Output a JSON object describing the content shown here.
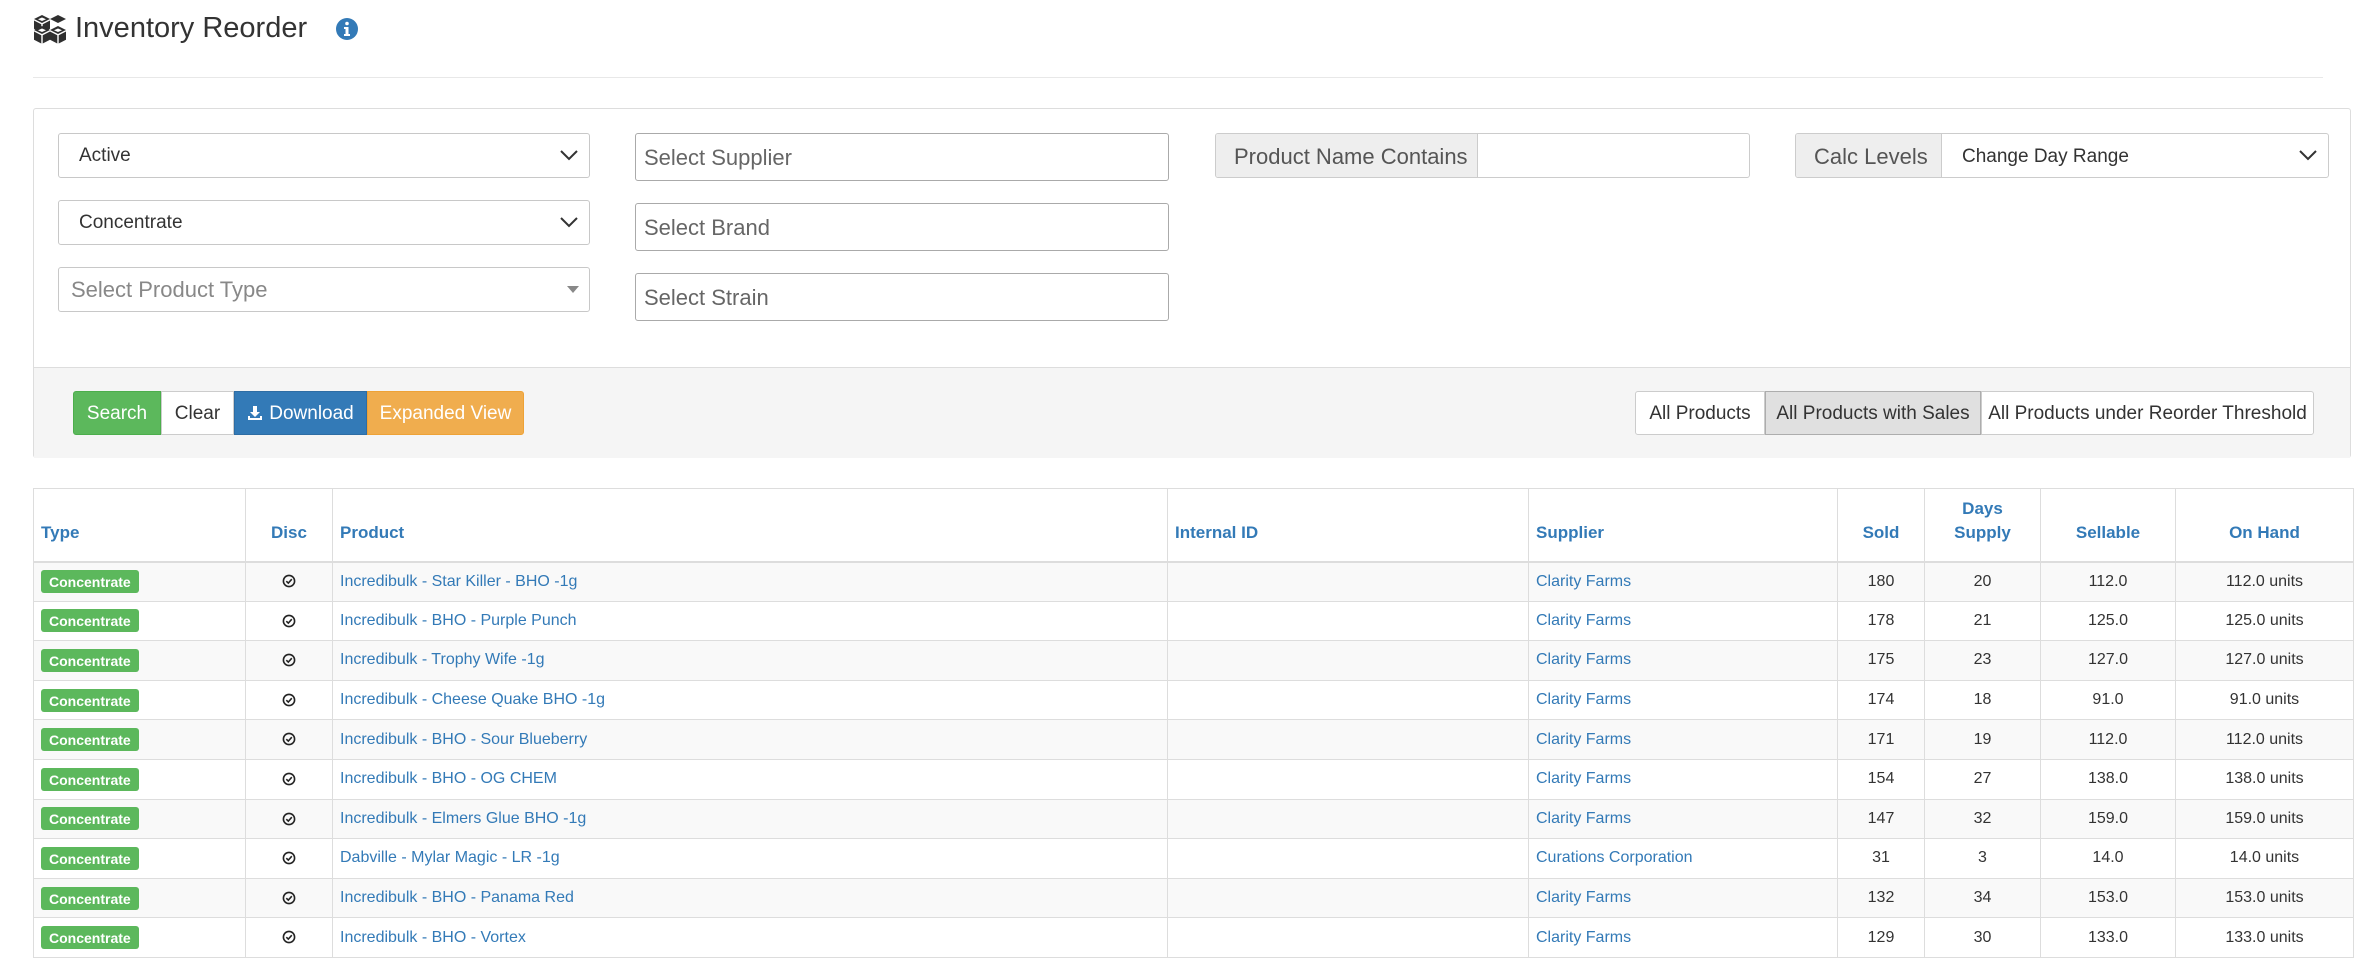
{
  "header": {
    "title": "Inventory Reorder"
  },
  "filters": {
    "status_select": "Active",
    "category_select": "Concentrate",
    "product_type_placeholder": "Select Product Type",
    "supplier_placeholder": "Select Supplier",
    "brand_placeholder": "Select Brand",
    "strain_placeholder": "Select Strain",
    "product_name_label": "Product Name Contains",
    "product_name_value": "",
    "calc_levels_label": "Calc Levels",
    "day_range_select": "Change Day Range"
  },
  "actions": {
    "search": "Search",
    "clear": "Clear",
    "download": "Download",
    "expanded": "Expanded View"
  },
  "views": {
    "all_products": "All Products",
    "all_with_sales": "All Products with Sales",
    "under_threshold": "All Products under Reorder Threshold",
    "active_view": "All Products with Sales"
  },
  "table": {
    "columns": {
      "type": "Type",
      "disc": "Disc",
      "product": "Product",
      "internal_id": "Internal ID",
      "supplier": "Supplier",
      "sold": "Sold",
      "days_supply_1": "Days",
      "days_supply_2": "Supply",
      "sellable": "Sellable",
      "on_hand": "On Hand"
    },
    "rows": [
      {
        "type": "Concentrate",
        "product": "Incredibulk - Star Killer - BHO -1g",
        "internal_id": "",
        "supplier": "Clarity Farms",
        "sold": "180",
        "days_supply": "20",
        "sellable": "112.0",
        "on_hand": "112.0 units"
      },
      {
        "type": "Concentrate",
        "product": "Incredibulk - BHO - Purple Punch",
        "internal_id": "",
        "supplier": "Clarity Farms",
        "sold": "178",
        "days_supply": "21",
        "sellable": "125.0",
        "on_hand": "125.0 units"
      },
      {
        "type": "Concentrate",
        "product": "Incredibulk - Trophy Wife -1g",
        "internal_id": "",
        "supplier": "Clarity Farms",
        "sold": "175",
        "days_supply": "23",
        "sellable": "127.0",
        "on_hand": "127.0 units"
      },
      {
        "type": "Concentrate",
        "product": "Incredibulk - Cheese Quake BHO -1g",
        "internal_id": "",
        "supplier": "Clarity Farms",
        "sold": "174",
        "days_supply": "18",
        "sellable": "91.0",
        "on_hand": "91.0 units"
      },
      {
        "type": "Concentrate",
        "product": "Incredibulk - BHO - Sour Blueberry",
        "internal_id": "",
        "supplier": "Clarity Farms",
        "sold": "171",
        "days_supply": "19",
        "sellable": "112.0",
        "on_hand": "112.0 units"
      },
      {
        "type": "Concentrate",
        "product": "Incredibulk - BHO - OG CHEM",
        "internal_id": "",
        "supplier": "Clarity Farms",
        "sold": "154",
        "days_supply": "27",
        "sellable": "138.0",
        "on_hand": "138.0 units"
      },
      {
        "type": "Concentrate",
        "product": "Incredibulk - Elmers Glue BHO -1g",
        "internal_id": "",
        "supplier": "Clarity Farms",
        "sold": "147",
        "days_supply": "32",
        "sellable": "159.0",
        "on_hand": "159.0 units"
      },
      {
        "type": "Concentrate",
        "product": "Dabville - Mylar Magic - LR -1g",
        "internal_id": "",
        "supplier": "Curations Corporation",
        "sold": "31",
        "days_supply": "3",
        "sellable": "14.0",
        "on_hand": "14.0 units"
      },
      {
        "type": "Concentrate",
        "product": "Incredibulk - BHO - Panama Red",
        "internal_id": "",
        "supplier": "Clarity Farms",
        "sold": "132",
        "days_supply": "34",
        "sellable": "153.0",
        "on_hand": "153.0 units"
      },
      {
        "type": "Concentrate",
        "product": "Incredibulk - BHO - Vortex",
        "internal_id": "",
        "supplier": "Clarity Farms",
        "sold": "129",
        "days_supply": "30",
        "sellable": "133.0",
        "on_hand": "133.0 units"
      }
    ]
  },
  "colors": {
    "link": "#337ab7",
    "success": "#5cb85c",
    "primary": "#337ab7",
    "warning": "#f0ad4e",
    "on_hand_text": "#3c8d2f"
  },
  "icons": {
    "title": "boxes-icon",
    "info": "info-circle-icon",
    "download": "download-icon",
    "disc": "check-circle-icon",
    "select": "chevron-down-icon"
  }
}
